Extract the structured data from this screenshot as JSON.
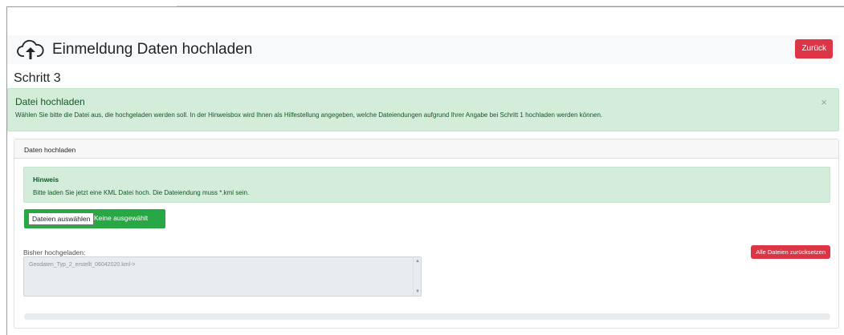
{
  "header": {
    "title": "Einmeldung Daten hochladen",
    "icon": "cloud-upload-icon",
    "back_label": "Zurück"
  },
  "step": {
    "title": "Schritt 3"
  },
  "alert": {
    "title": "Datei hochladen",
    "text": "Wählen Sie bitte die Datei aus, die hochgeladen werden soll. In der Hinweisbox wird Ihnen als Hilfestellung angegeben, welche Dateiendungen aufgrund Ihrer Angabe bei Schritt 1 hochladen werden können.",
    "close": "×"
  },
  "card": {
    "header": "Daten hochladen",
    "hint": {
      "title": "Hinweis",
      "text": "Bitte laden Sie jetzt eine KML Datei hoch. Die Dateiendung muss *.kml sein."
    },
    "file": {
      "button_label": "Dateien auswählen",
      "status": "Keine ausgewählt"
    },
    "uploaded": {
      "label": "Bisher hochgeladen:",
      "value": "Geodaten_Typ_2_erstellt_06042020.kml->"
    },
    "reset_label": "Alle Dateien zurücksetzen",
    "progress": 0
  },
  "colors": {
    "danger": "#dc3545",
    "success": "#28a745",
    "alert_bg": "#d4edda",
    "alert_text": "#155724"
  }
}
